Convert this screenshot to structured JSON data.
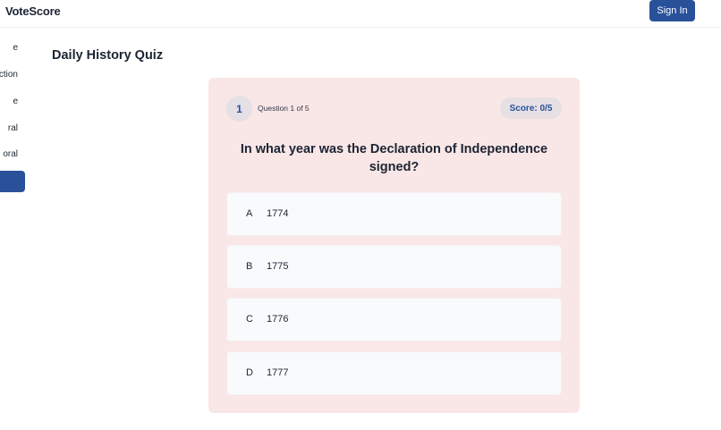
{
  "header": {
    "brand": "VoteScore",
    "sign_in_label": "Sign In"
  },
  "sidebar": {
    "items": [
      {
        "label": "e"
      },
      {
        "label": "ction"
      },
      {
        "label": "e"
      },
      {
        "label": "ral"
      },
      {
        "label": "oral"
      }
    ]
  },
  "page": {
    "title": "Daily History Quiz"
  },
  "quiz": {
    "question_number": "1",
    "progress": "Question 1 of 5",
    "score": "Score: 0/5",
    "question": "In what year was the Declaration of Independence signed?",
    "options": [
      {
        "letter": "A",
        "answer": "1774"
      },
      {
        "letter": "B",
        "answer": "1775"
      },
      {
        "letter": "C",
        "answer": "1776"
      },
      {
        "letter": "D",
        "answer": "1777"
      }
    ]
  },
  "colors": {
    "accent": "#28519a",
    "card_background": "#f9e6e6",
    "option_background": "#f9fafb"
  }
}
